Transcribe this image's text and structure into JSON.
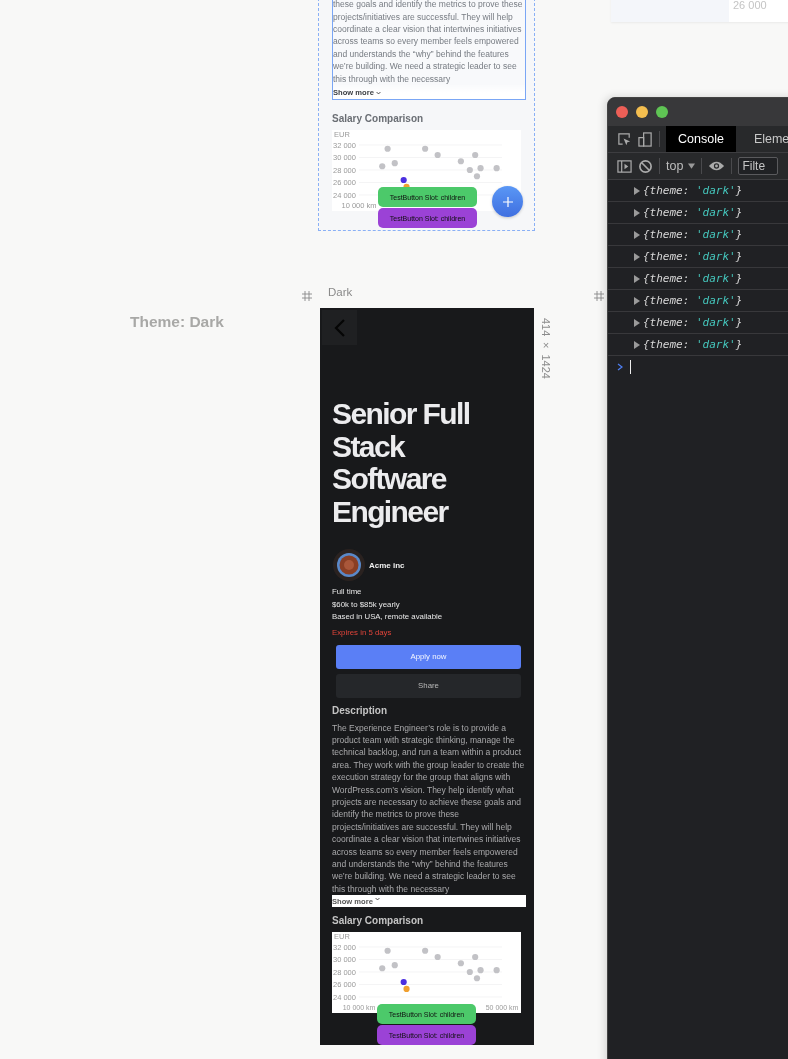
{
  "top_card": {
    "text": "26 000"
  },
  "canvas_label": "Theme: Dark",
  "light_frame": {
    "description": "these goals and identify the metrics to prove these projects/initiatives are successful. They will help coordinate a clear vision that intertwines initiatives across teams so every member feels empowered and understands the “why” behind the features we’re building. We need a strategic leader to see this through with the necessary",
    "show_more": "Show more",
    "salary_heading": "Salary Comparison",
    "chart": {
      "ylabel": "EUR",
      "y_labels": [
        "32 000",
        "30 000",
        "28 000",
        "26 000",
        "24 000"
      ],
      "x_label": "10 000 km"
    },
    "test_buttons": [
      {
        "label": "TestButton Slot: children",
        "color": "#4cc96a"
      },
      {
        "label": "TestButton Slot: children",
        "color": "#9b42d6"
      }
    ]
  },
  "dark_frame": {
    "name": "Dark",
    "size": "414 × 1424",
    "title": "Senior Full Stack Software Engineer",
    "company": "Acme inc",
    "details": [
      "Full time",
      "$60k to $85k yearly",
      "Based in USA, remote available"
    ],
    "expiry": "Expires in 5 days",
    "primary_button": "Apply now",
    "secondary_button": "Share",
    "description_heading": "Description",
    "description": "The Experience Engineer’s role is to provide a product team with strategic thinking, manage the technical backlog, and run a team within a product area. They work with the group leader to create the execution strategy for the group that aligns with WordPress.com’s vision. They help identify what projects are necessary to achieve these goals and identify the metrics to prove these projects/initiatives are successful. They will help coordinate a clear vision that intertwines initiatives across teams so every member feels empowered and understands the “why” behind the features we’re building. We need a strategic leader to see this through with the necessary",
    "show_more": "Show more",
    "salary_heading": "Salary Comparison",
    "chart_data": {
      "type": "scatter",
      "grid": true,
      "ylabel": "EUR",
      "xlim": [
        10000,
        50000
      ],
      "ylim": [
        24000,
        32000
      ],
      "xticks": [
        {
          "value": 10000,
          "label": "10 000 km"
        },
        {
          "value": 50000,
          "label": "50 000 km"
        }
      ],
      "yticks": [
        {
          "value": 32000,
          "label": "32 000"
        },
        {
          "value": 30000,
          "label": "30 000"
        },
        {
          "value": 28000,
          "label": "28 000"
        },
        {
          "value": 26000,
          "label": "26 000"
        },
        {
          "value": 24000,
          "label": "24 000"
        }
      ],
      "x": [
        16500,
        18000,
        20000,
        22500,
        23300,
        28500,
        32000,
        38500,
        41000,
        42500,
        43000,
        44000,
        48500
      ],
      "series": [
        {
          "color": "#c2c2c6",
          "values": [
            28600,
            31400,
            29100,
            null,
            null,
            31400,
            30400,
            29400,
            28000,
            30400,
            27000,
            28300,
            28300
          ]
        },
        {
          "color": "#4b2fe0",
          "values": [
            null,
            null,
            null,
            26400,
            null,
            null,
            null,
            null,
            null,
            null,
            null,
            null,
            null
          ]
        },
        {
          "color": "#f0a030",
          "values": [
            null,
            null,
            null,
            null,
            25300,
            null,
            null,
            null,
            null,
            null,
            null,
            null,
            null
          ]
        }
      ]
    },
    "test_buttons": [
      {
        "label": "TestButton Slot: children",
        "color": "#4cc96a"
      },
      {
        "label": "TestButton Slot: children",
        "color": "#9b42d6"
      }
    ]
  },
  "devtools": {
    "tabs": [
      {
        "label": "Console",
        "selected": true
      },
      {
        "label": "Eleme",
        "selected": false
      }
    ],
    "context": "top",
    "filter_placeholder": "Filte",
    "entries": [
      {
        "expanded": false,
        "open": "{theme:",
        "value": "'dark'",
        "close": "}"
      },
      {
        "expanded": false,
        "open": "{theme:",
        "value": "'dark'",
        "close": "}"
      },
      {
        "expanded": false,
        "open": "{theme:",
        "value": "'dark'",
        "close": "}"
      },
      {
        "expanded": false,
        "open": "{theme:",
        "value": "'dark'",
        "close": "}"
      },
      {
        "expanded": false,
        "open": "{theme:",
        "value": "'dark'",
        "close": "}"
      },
      {
        "expanded": false,
        "open": "{theme:",
        "value": "'dark'",
        "close": "}"
      },
      {
        "expanded": false,
        "open": "{theme:",
        "value": "'dark'",
        "close": "}"
      },
      {
        "expanded": false,
        "open": "{theme:",
        "value": "'dark'",
        "close": "}"
      }
    ]
  }
}
